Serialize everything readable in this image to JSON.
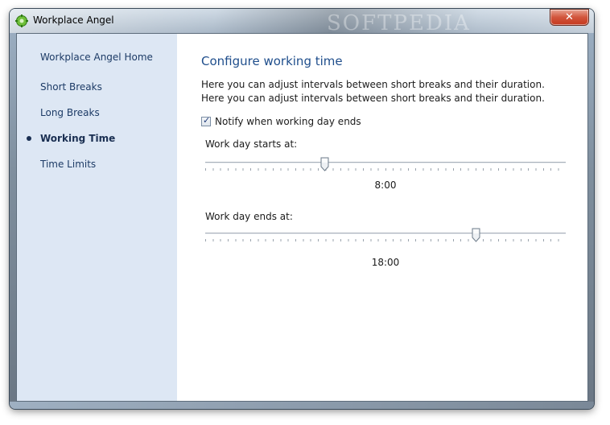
{
  "window": {
    "title": "Workplace Angel",
    "watermark": "SOFTPEDIA",
    "close_label": "✕"
  },
  "sidebar": {
    "items": [
      {
        "label": "Workplace Angel Home",
        "active": false
      },
      {
        "label": "Short Breaks",
        "active": false
      },
      {
        "label": "Long Breaks",
        "active": false
      },
      {
        "label": "Working Time",
        "active": true
      },
      {
        "label": "Time Limits",
        "active": false
      }
    ]
  },
  "main": {
    "heading": "Configure working time",
    "description": "Here you can adjust intervals between short breaks and their duration. Here you can adjust intervals between short breaks and their duration.",
    "notify_checkbox": {
      "label": "Notify when working day ends",
      "checked": true
    },
    "start_slider": {
      "label": "Work day starts at:",
      "value_text": "8:00",
      "fraction": 0.33
    },
    "end_slider": {
      "label": "Work day ends at:",
      "value_text": "18:00",
      "fraction": 0.75
    }
  },
  "colors": {
    "sidebar_bg": "#dde7f4",
    "heading": "#1f4e8c",
    "close_button": "#c4381e"
  }
}
